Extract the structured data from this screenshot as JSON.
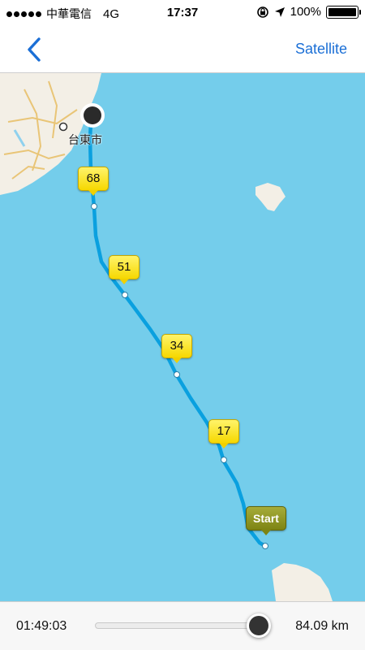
{
  "status_bar": {
    "carrier": "中華電信",
    "network": "4G",
    "time": "17:37",
    "battery_percent": "100%",
    "icons": [
      "signal-dots",
      "rotation-lock-icon",
      "location-arrow-icon",
      "battery-icon"
    ]
  },
  "nav": {
    "back_icon": "chevron-left-icon",
    "right_button_label": "Satellite",
    "accent_color": "#1b6fd6"
  },
  "map": {
    "city_label": "台東市",
    "markers": [
      {
        "label": "68",
        "kind": "distance"
      },
      {
        "label": "51",
        "kind": "distance"
      },
      {
        "label": "34",
        "kind": "distance"
      },
      {
        "label": "17",
        "kind": "distance"
      },
      {
        "label": "Start",
        "kind": "start"
      }
    ],
    "route_color": "#0aa0df",
    "water_color": "#74cdeb",
    "land_color": "#f3efe6"
  },
  "playback": {
    "elapsed": "01:49:03",
    "distance": "84.09 km",
    "progress_fraction": 0.94
  }
}
